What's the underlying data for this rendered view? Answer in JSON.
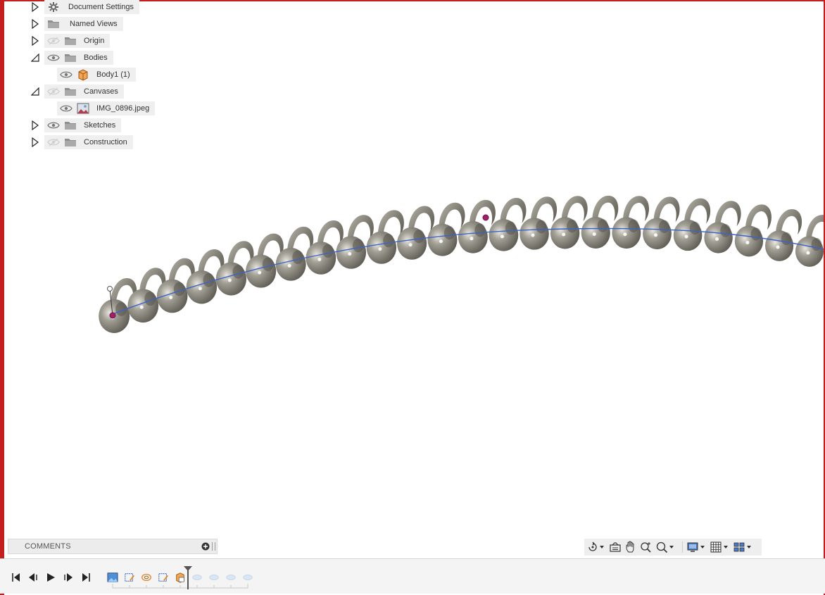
{
  "browser": {
    "items": [
      {
        "label": "Document Settings",
        "icon": "gear-icon",
        "expander": "collapsed",
        "eye": "none"
      },
      {
        "label": "Named Views",
        "icon": "folder-icon",
        "expander": "collapsed",
        "eye": "none"
      },
      {
        "label": "Origin",
        "icon": "folder-icon",
        "expander": "collapsed",
        "eye": "hidden"
      },
      {
        "label": "Bodies",
        "icon": "folder-icon",
        "expander": "expanded",
        "eye": "visible"
      },
      {
        "label": "Body1 (1)",
        "icon": "body-icon",
        "expander": "none",
        "eye": "visible"
      },
      {
        "label": "Canvases",
        "icon": "folder-icon",
        "expander": "expanded",
        "eye": "hidden"
      },
      {
        "label": "IMG_0896.jpeg",
        "icon": "image-icon",
        "expander": "none",
        "eye": "visible"
      },
      {
        "label": "Sketches",
        "icon": "folder-icon",
        "expander": "collapsed",
        "eye": "visible"
      },
      {
        "label": "Construction",
        "icon": "folder-icon",
        "expander": "collapsed",
        "eye": "hidden"
      }
    ]
  },
  "comments": {
    "title": "COMMENTS"
  },
  "navbar": {
    "tools": [
      "orbit-icon",
      "look-at-icon",
      "pan-icon",
      "zoom-icon",
      "fit-icon",
      "display-settings-icon",
      "grid-icon",
      "viewports-icon"
    ]
  },
  "timeline": {
    "controls": [
      "go-to-start-icon",
      "step-back-icon",
      "play-icon",
      "step-forward-icon",
      "go-to-end-icon"
    ],
    "features": [
      "canvas-feature-icon",
      "sketch-feature-icon",
      "coil-feature-icon",
      "sketch-feature-icon",
      "body-feature-icon",
      "suppressed-feature-icon",
      "suppressed-feature-icon",
      "suppressed-feature-icon",
      "suppressed-feature-icon"
    ]
  },
  "colors": {
    "frame": "#c41e1e",
    "coil": "#8c8a82",
    "path": "#3b63c9",
    "point": "#a0206a",
    "accent_orange": "#e8892b"
  }
}
